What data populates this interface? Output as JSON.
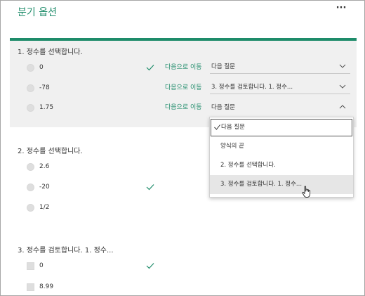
{
  "header": {
    "title": "분기 옵션",
    "more_label": "···"
  },
  "questions": [
    {
      "title": "1. 정수를 선택합니다.",
      "options": [
        {
          "label": "0",
          "goto": "다음으로 이동",
          "branch": "다음 질문"
        },
        {
          "label": "-78",
          "goto": "다음으로 이동",
          "branch": "3. 정수를 검토합니다. 1. 정수..."
        },
        {
          "label": "1.75",
          "goto": "다음으로 이동",
          "branch": "다음 질문"
        }
      ]
    },
    {
      "title": "2. 정수를 선택합니다.",
      "options": [
        {
          "label": "2.6"
        },
        {
          "label": "-20"
        },
        {
          "label": "1/2"
        }
      ]
    },
    {
      "title": "3. 정수를 검토합니다. 1. 정수...",
      "options": [
        {
          "label": "0"
        },
        {
          "label": "8.99"
        }
      ]
    }
  ],
  "dropdown": {
    "items": [
      {
        "label": "다음 질문"
      },
      {
        "label": "양식의 끝"
      },
      {
        "label": "2. 정수를 선택합니다."
      },
      {
        "label": "3. 정수를 검토합니다. 1. 정수..."
      }
    ]
  },
  "colors": {
    "accent": "#1e8c6a",
    "panel": "#f0f0f0",
    "hover": "#e6e6e6"
  }
}
